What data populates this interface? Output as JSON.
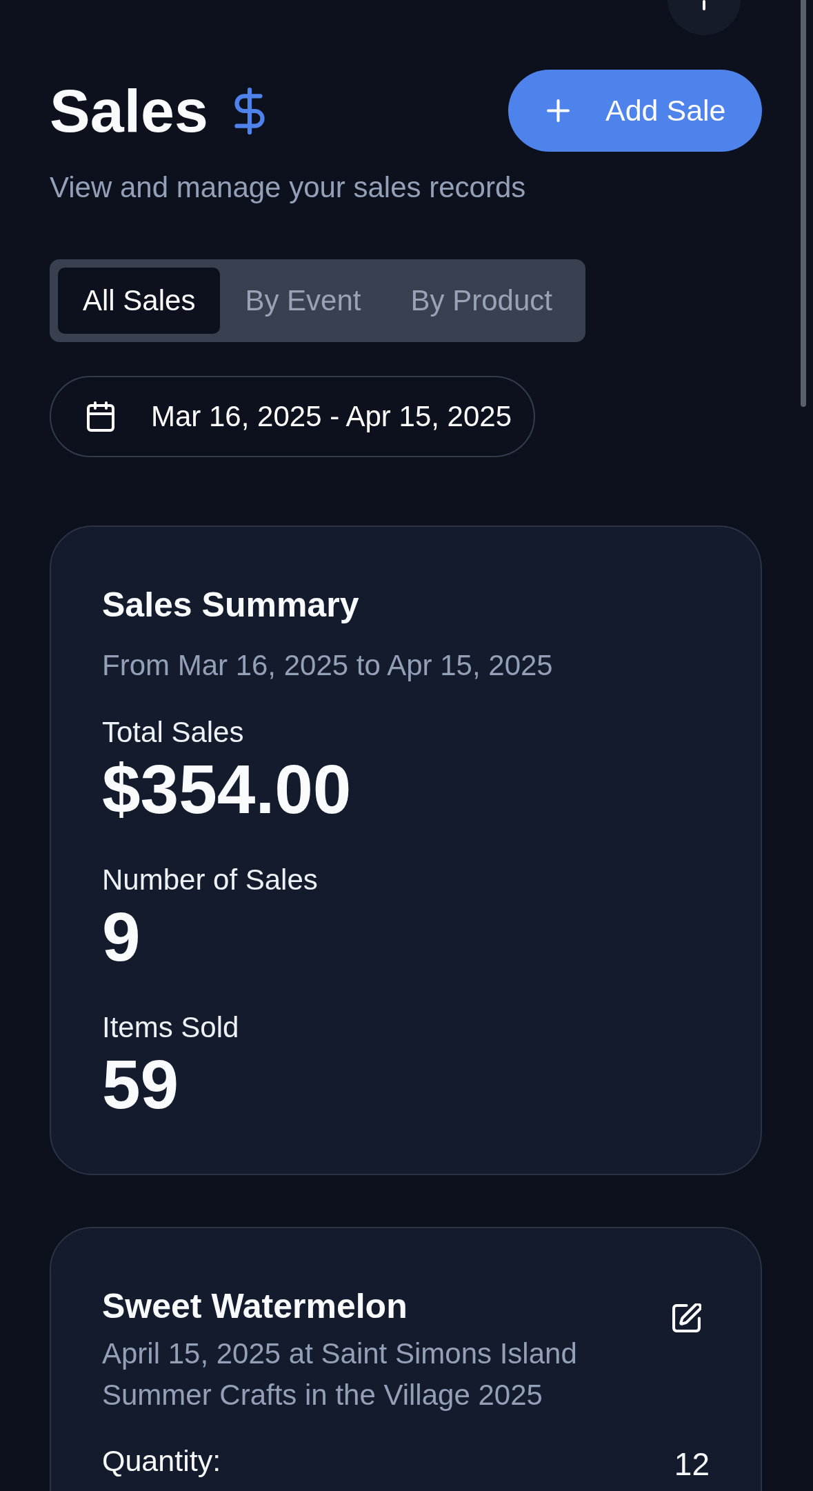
{
  "header": {
    "title": "Sales",
    "add_button": "Add Sale"
  },
  "subtitle": "View and manage your sales records",
  "tabs": [
    {
      "label": "All Sales",
      "selected": true
    },
    {
      "label": "By Event",
      "selected": false
    },
    {
      "label": "By Product",
      "selected": false
    }
  ],
  "date_range": "Mar 16, 2025 - Apr 15, 2025",
  "summary": {
    "title": "Sales Summary",
    "period": "From Mar 16, 2025 to Apr 15, 2025",
    "stats": [
      {
        "label": "Total Sales",
        "value": "$354.00"
      },
      {
        "label": "Number of Sales",
        "value": "9"
      },
      {
        "label": "Items Sold",
        "value": "59"
      }
    ]
  },
  "sales": [
    {
      "product": "Sweet Watermelon",
      "detail": "April 15, 2025 at Saint Simons Island Summer Crafts in the Village 2025",
      "fields": [
        {
          "label": "Quantity:",
          "value": "12"
        }
      ]
    }
  ]
}
